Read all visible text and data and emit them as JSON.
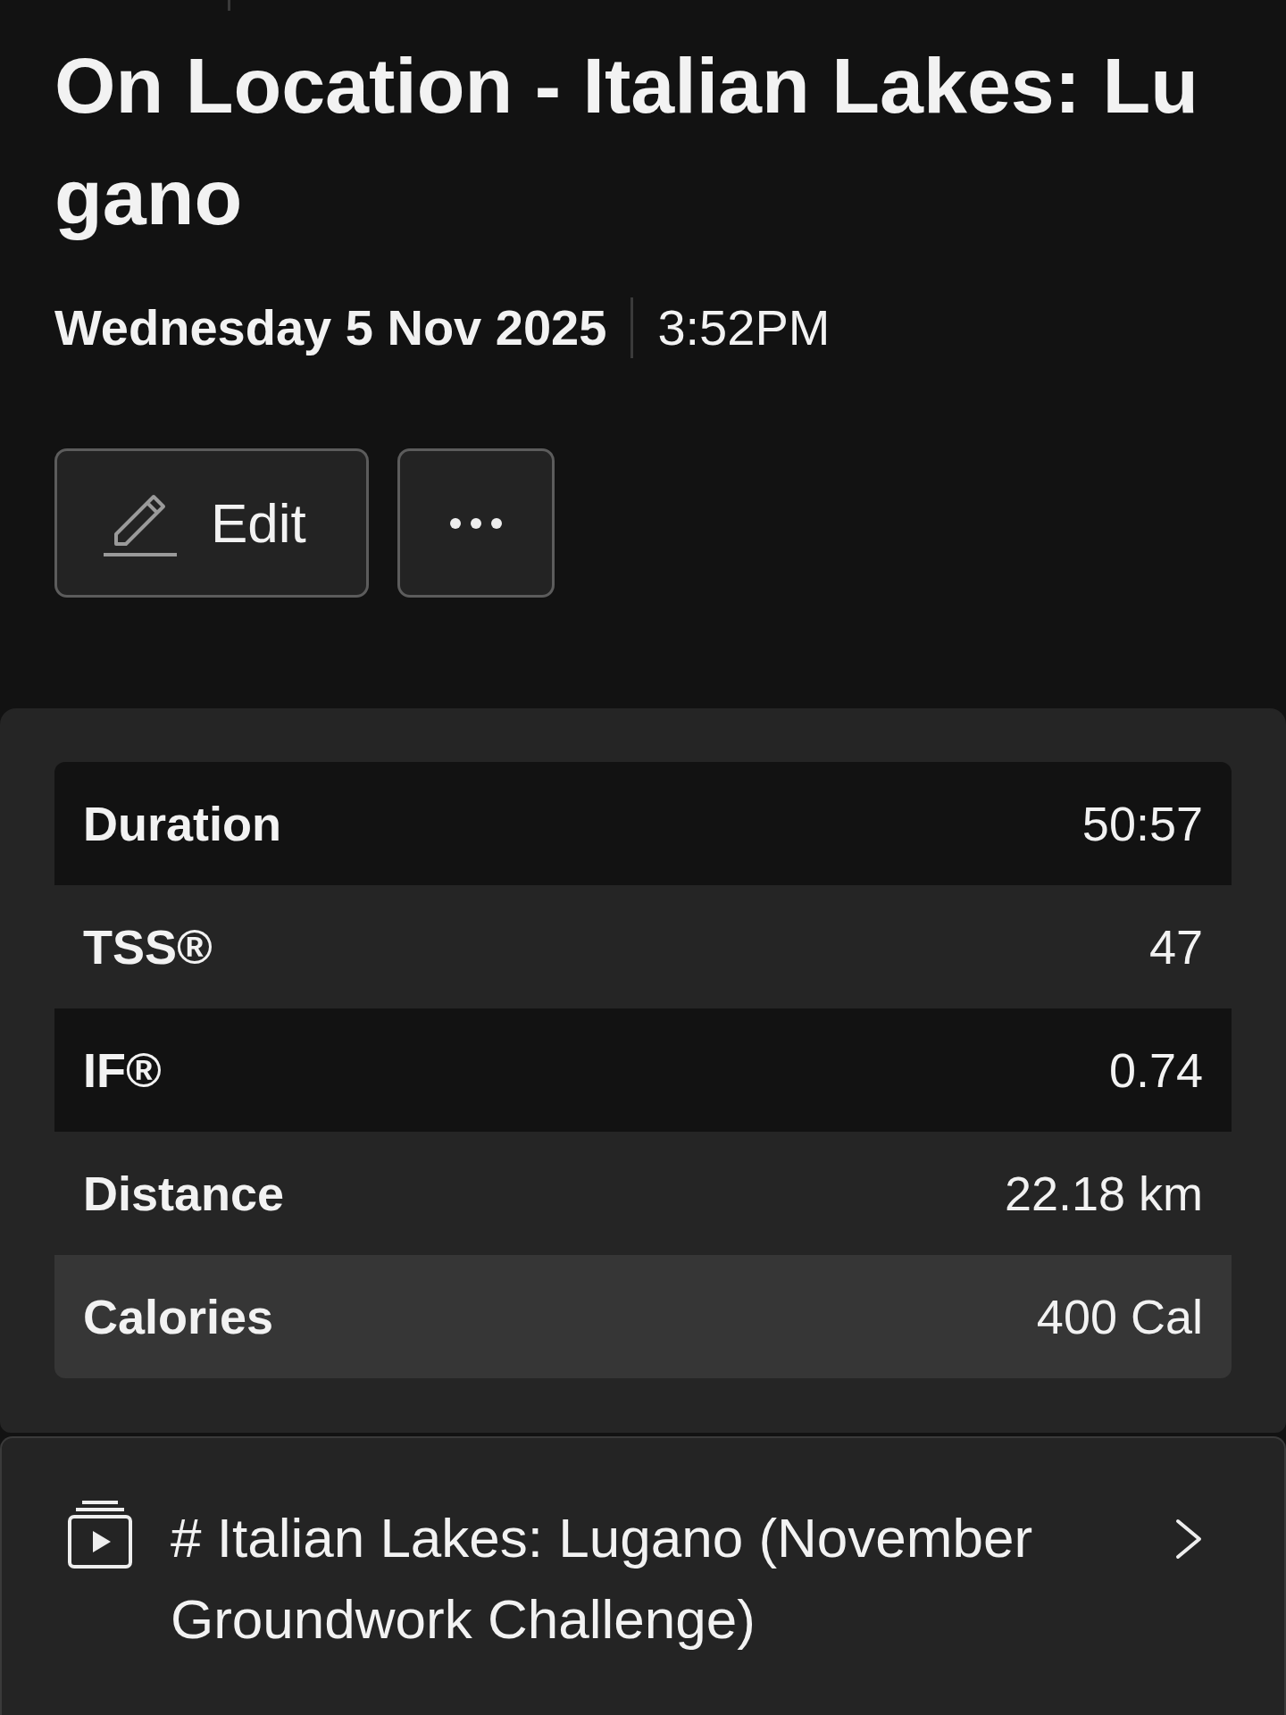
{
  "activity": {
    "title": "On Location - Italian Lakes: Lugano",
    "date": "Wednesday 5 Nov 2025",
    "time": "3:52PM"
  },
  "actions": [
    {
      "kind": "edit",
      "label": "Edit"
    },
    {
      "kind": "more"
    }
  ],
  "stats": {
    "rows": [
      {
        "label": "Duration",
        "value": "50:57",
        "highlighted": false
      },
      {
        "label": "TSS®",
        "value": "47",
        "highlighted": false
      },
      {
        "label": "IF®",
        "value": "0.74",
        "highlighted": false
      },
      {
        "label": "Distance",
        "value": "22.18 km",
        "highlighted": false
      },
      {
        "label": "Calories",
        "value": "400 Cal",
        "highlighted": true
      }
    ]
  },
  "series_link": {
    "title": "# Italian Lakes: Lugano (November Groundwork Challenge)"
  }
}
